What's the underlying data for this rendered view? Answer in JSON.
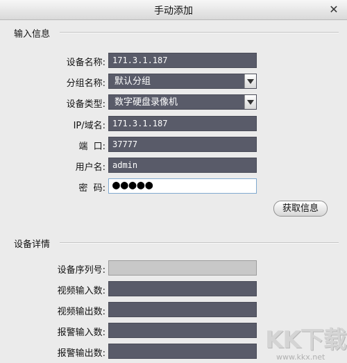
{
  "window": {
    "title": "手动添加",
    "close_glyph": "✕"
  },
  "input_section": {
    "heading": "输入信息",
    "fields": {
      "device_name": {
        "label": "设备名称:",
        "value": "171.3.1.187"
      },
      "group_name": {
        "label": "分组名称:",
        "value": "默认分组"
      },
      "device_type": {
        "label": "设备类型:",
        "value": "数字硬盘录像机"
      },
      "ip_domain": {
        "label": "IP/域名:",
        "value": "171.3.1.187"
      },
      "port": {
        "label": "端  口:",
        "value": "37777"
      },
      "username": {
        "label": "用户名:",
        "value": "admin"
      },
      "password": {
        "label": "密  码:",
        "value": "●●●●●"
      }
    },
    "get_info_button": "获取信息"
  },
  "details_section": {
    "heading": "设备详情",
    "fields": {
      "serial_number": {
        "label": "设备序列号:",
        "value": ""
      },
      "video_inputs": {
        "label": "视频输入数:",
        "value": ""
      },
      "video_outputs": {
        "label": "视频输出数:",
        "value": ""
      },
      "alarm_inputs": {
        "label": "报警输入数:",
        "value": ""
      },
      "alarm_outputs": {
        "label": "报警输出数:",
        "value": ""
      }
    }
  },
  "watermark": {
    "text": "KK下载",
    "url": "www.kkx.net"
  },
  "colors": {
    "field_bg": "#595b69",
    "dialog_bg": "#ebebeb",
    "disabled_field_bg": "#c8c8c8",
    "password_border": "#7fa9cf"
  }
}
